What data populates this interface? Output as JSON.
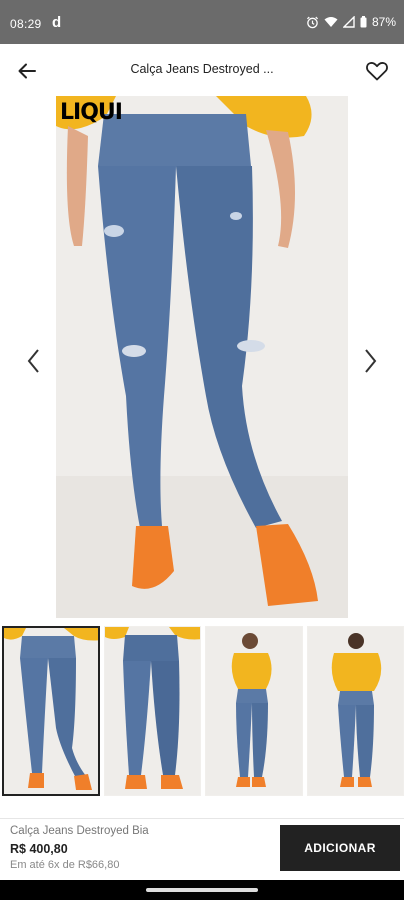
{
  "status_bar": {
    "time": "08:29",
    "app_letter": "d",
    "battery": "87%"
  },
  "header": {
    "title": "Calça Jeans Destroyed ..."
  },
  "main_image": {
    "brand_logo": "LIQUI"
  },
  "thumbnails": [
    {
      "selected": true
    },
    {
      "selected": false
    },
    {
      "selected": false
    },
    {
      "selected": false
    }
  ],
  "product": {
    "name": "Calça Jeans Destroyed Bia",
    "price": "R$ 400,80",
    "installments": "Em até 6x de R$66,80"
  },
  "actions": {
    "add_label": "ADICIONAR"
  },
  "colors": {
    "accent": "#222222",
    "status_bar": "#6b6b6b",
    "top_yellow": "#f2b51f",
    "denim": "#4f6f9c",
    "shoes": "#f07f2a"
  }
}
